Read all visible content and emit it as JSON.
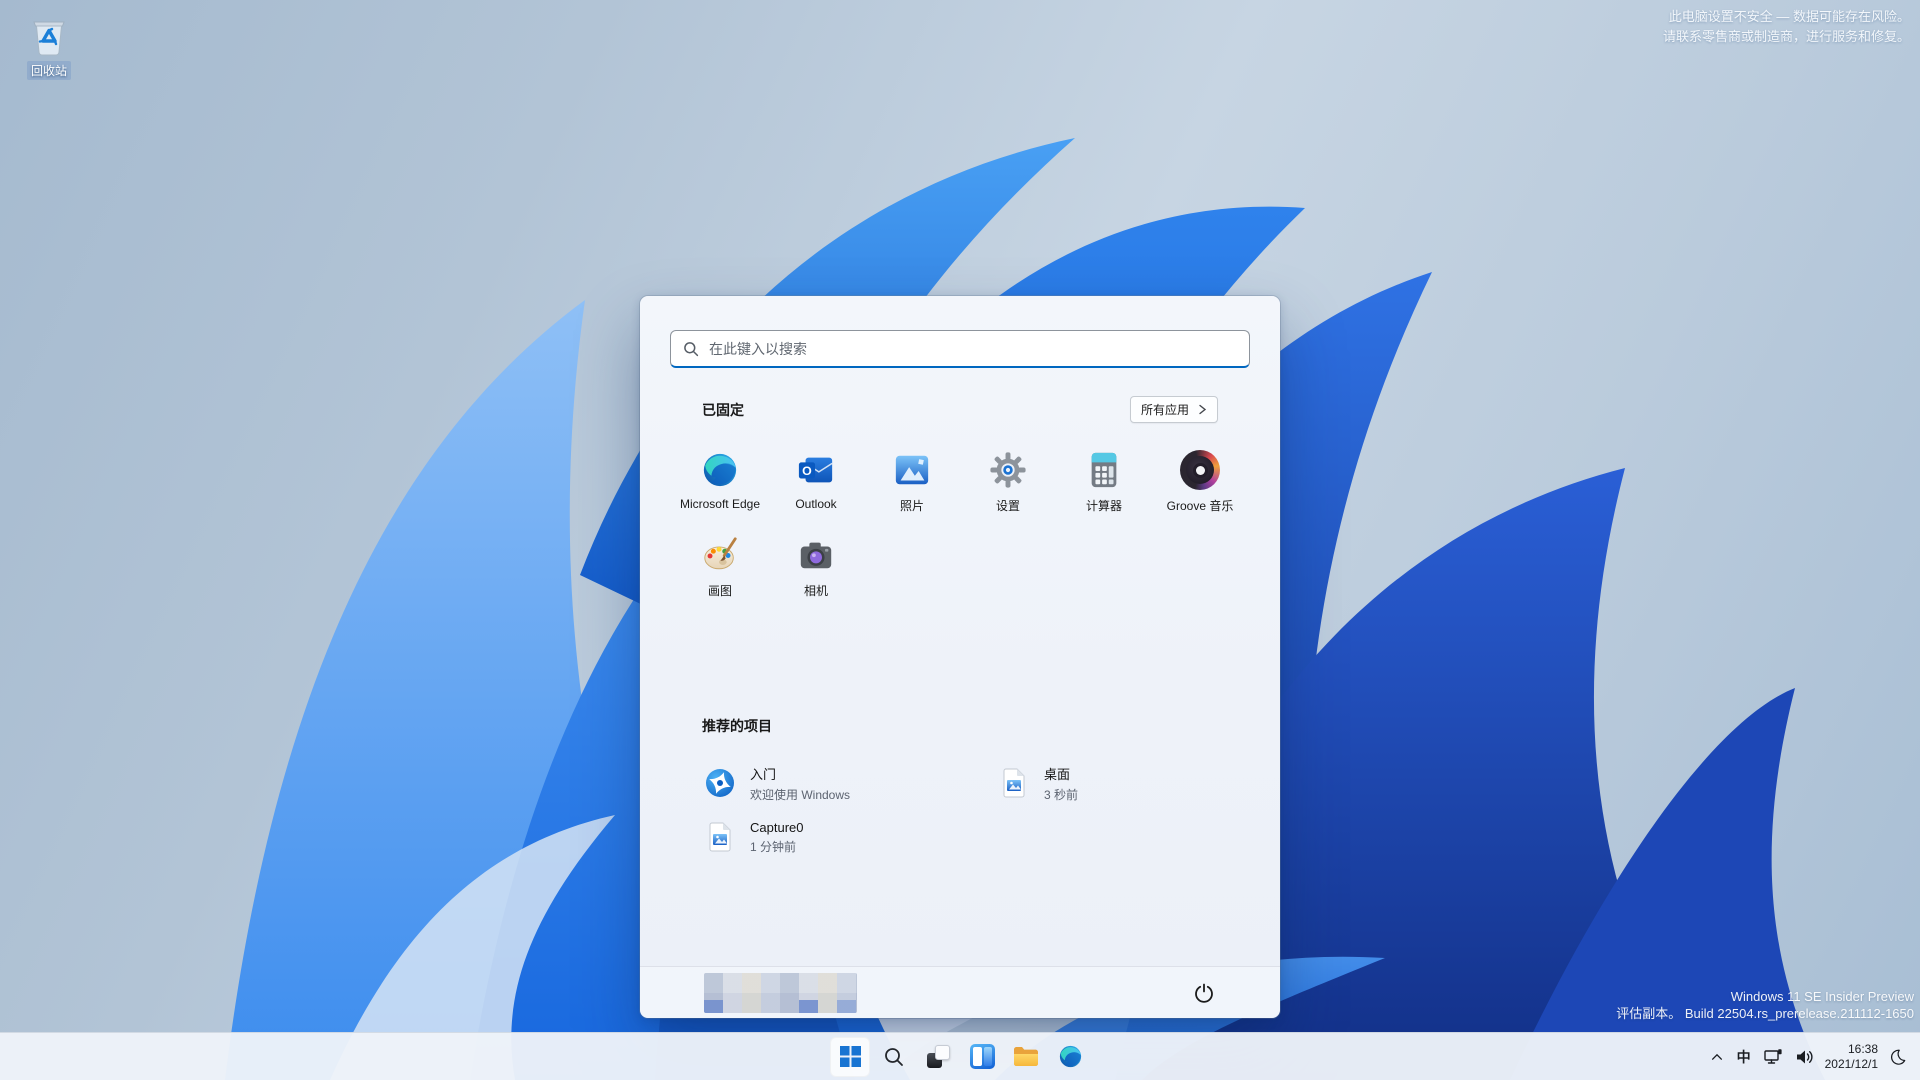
{
  "desktop": {
    "recycle_bin_label": "回收站",
    "warning_line1": "此电脑设置不安全 — 数据可能存在风险。",
    "warning_line2": "请联系零售商或制造商，进行服务和修复。",
    "watermark_line1": "Windows 11 SE Insider Preview",
    "watermark_line2": "评估副本。 Build 22504.rs_prerelease.211112-1650"
  },
  "start_menu": {
    "search_placeholder": "在此键入以搜索",
    "pinned_header": "已固定",
    "all_apps_label": "所有应用",
    "pinned_apps": [
      {
        "label": "Microsoft Edge",
        "icon": "edge-icon"
      },
      {
        "label": "Outlook",
        "icon": "outlook-icon"
      },
      {
        "label": "照片",
        "icon": "photos-icon"
      },
      {
        "label": "设置",
        "icon": "settings-gear-icon"
      },
      {
        "label": "计算器",
        "icon": "calculator-icon"
      },
      {
        "label": "Groove 音乐",
        "icon": "groove-music-icon"
      },
      {
        "label": "画图",
        "icon": "paint-palette-icon"
      },
      {
        "label": "相机",
        "icon": "camera-icon"
      }
    ],
    "recommended_header": "推荐的项目",
    "recommended": [
      {
        "title": "入门",
        "subtitle": "欢迎使用 Windows",
        "icon": "get-started-icon"
      },
      {
        "title": "桌面",
        "subtitle": "3 秒前",
        "icon": "image-file-icon"
      },
      {
        "title": "Capture0",
        "subtitle": "1 分钟前",
        "icon": "image-file-icon"
      }
    ]
  },
  "taskbar": {
    "tray": {
      "ime_label": "中",
      "time": "16:38",
      "date": "2021/12/1"
    }
  },
  "colors": {
    "accent": "#0067c0",
    "start_menu_bg": "#eef2f9",
    "taskbar_bg": "#eef2f9",
    "wallpaper_bright_blue": "#2f82ec",
    "wallpaper_dark_blue": "#16348f",
    "warning_text": "#f3f7fb"
  }
}
